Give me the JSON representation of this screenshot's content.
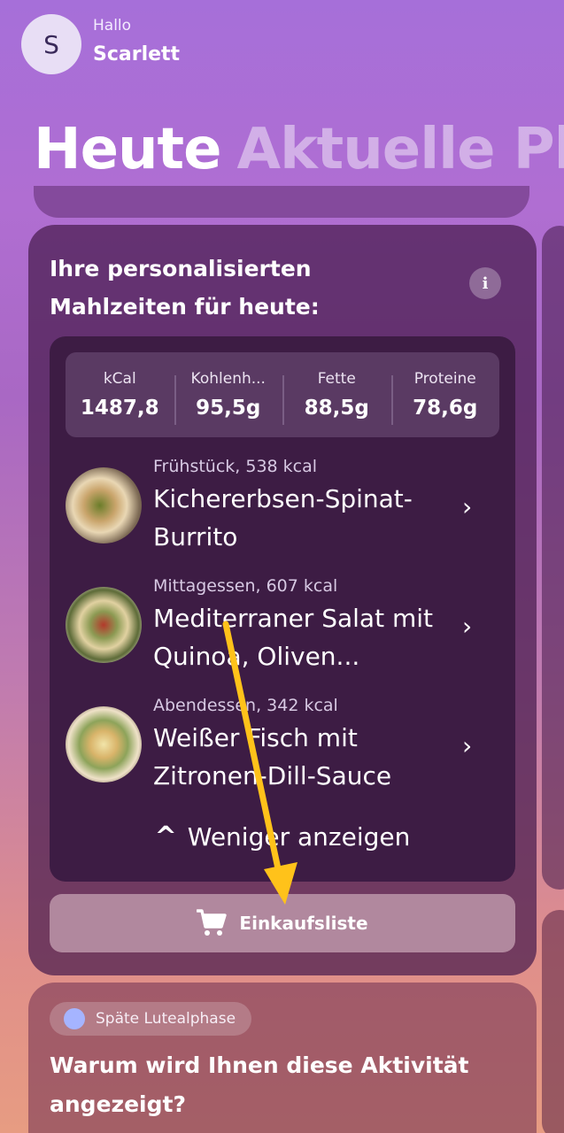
{
  "header": {
    "avatar_initial": "S",
    "greeting": "Hallo",
    "user_name": "Scarlett"
  },
  "page_title": {
    "primary": "Heute",
    "secondary": "Aktuelle Pho"
  },
  "meals_card": {
    "heading": "Ihre personalisierten Mahlzeiten für heute:",
    "info_icon": "info-icon",
    "info_glyph": "i",
    "stats": [
      {
        "label": "kCal",
        "value": "1487,8"
      },
      {
        "label": "Kohlenh...",
        "value": "95,5g"
      },
      {
        "label": "Fette",
        "value": "88,5g"
      },
      {
        "label": "Proteine",
        "value": "78,6g"
      }
    ],
    "meals": [
      {
        "meta": "Frühstück, 538 kcal",
        "title": "Kichererbsen-Spinat-Burrito",
        "icon": "chevron-right-icon"
      },
      {
        "meta": "Mittagessen, 607 kcal",
        "title": "Mediterraner Salat mit Quinoa, Oliven...",
        "icon": "chevron-right-icon"
      },
      {
        "meta": "Abendessen, 342 kcal",
        "title": "Weißer Fisch mit Zitronen-Dill-Sauce",
        "icon": "chevron-right-icon"
      }
    ],
    "chevron_glyph": "›",
    "show_less_label": "Weniger anzeigen",
    "show_less_icon": "chevron-up-icon",
    "show_less_glyph": "^",
    "shopping_list_label": "Einkaufsliste",
    "shopping_icon": "cart-icon"
  },
  "activity_card": {
    "phase_label": "Späte Lutealphase",
    "phase_dot_color": "#a5b4ff",
    "question": "Warum wird Ihnen diese Aktivität angezeigt?"
  },
  "annotation": {
    "arrow_color": "#ffc21a"
  }
}
